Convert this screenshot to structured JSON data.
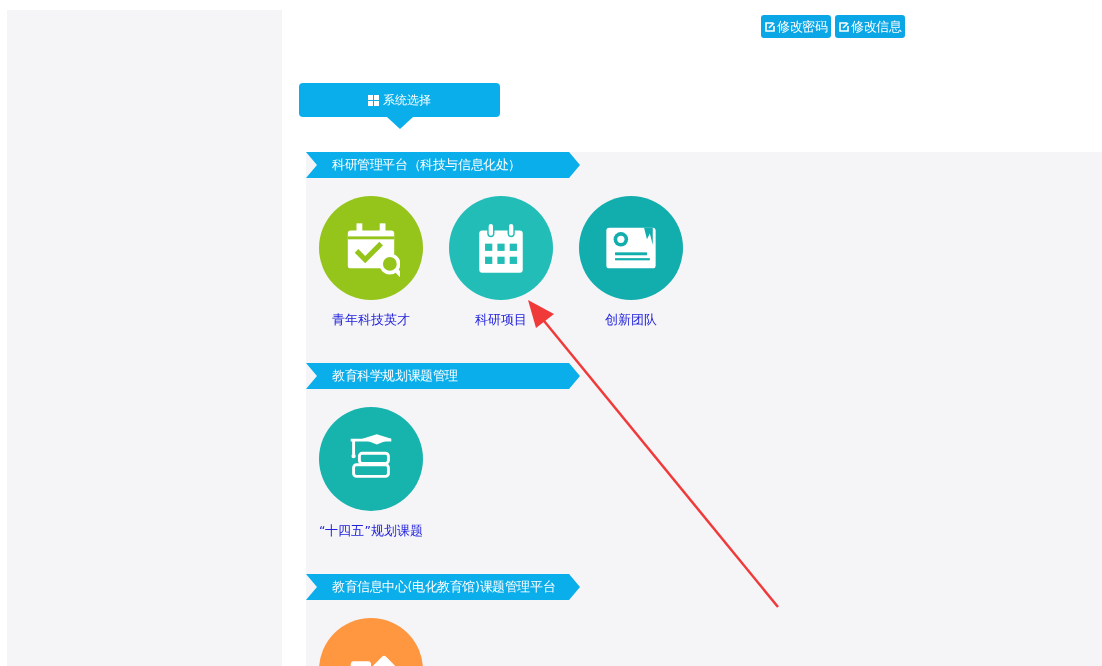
{
  "top_buttons": [
    {
      "label": "修改密码"
    },
    {
      "label": "修改信息"
    }
  ],
  "system_tab": {
    "label": "系统选择"
  },
  "sections": [
    {
      "title": "科研管理平台（科技与信息化处）",
      "items": [
        {
          "label": "青年科技英才",
          "kind": "calendar-check",
          "color": "#95c51a"
        },
        {
          "label": "科研项目",
          "kind": "calendar",
          "color": "#23bdb8"
        },
        {
          "label": "创新团队",
          "kind": "certificate",
          "color": "#12adad"
        }
      ]
    },
    {
      "title": "教育科学规划课题管理",
      "items": [
        {
          "label": "“十四五”规划课题",
          "kind": "books",
          "color": "#17b3ad"
        }
      ]
    },
    {
      "title": "教育信息中心(电化教育馆)课题管理平台",
      "items": [
        {
          "kind": "shapes",
          "color": "#ff9640"
        }
      ]
    }
  ]
}
